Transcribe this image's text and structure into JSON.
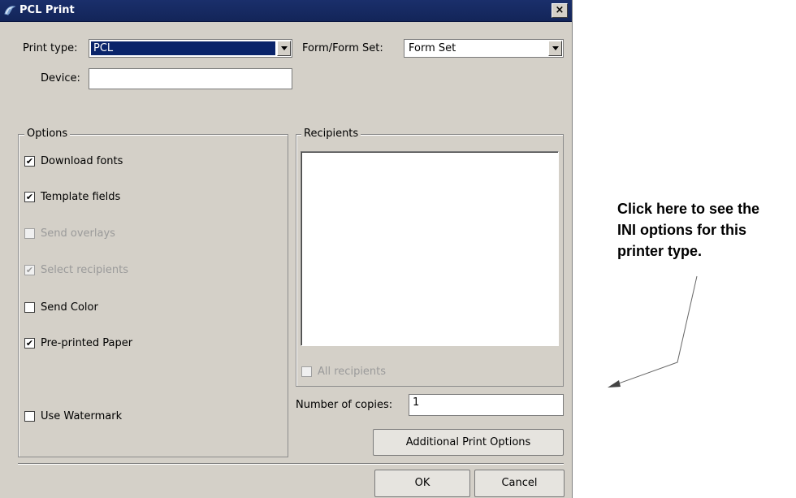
{
  "window": {
    "title": "PCL Print",
    "close_glyph": "×"
  },
  "print_type": {
    "label": "Print type:",
    "value": "PCL"
  },
  "form": {
    "label": "Form/Form Set:",
    "value": "Form Set"
  },
  "device": {
    "label": "Device:",
    "value": ""
  },
  "options": {
    "legend": "Options",
    "items": [
      {
        "label": "Download fonts",
        "checked": true,
        "enabled": true
      },
      {
        "label": "Template fields",
        "checked": true,
        "enabled": true
      },
      {
        "label": "Send overlays",
        "checked": false,
        "enabled": false
      },
      {
        "label": "Select recipients",
        "checked": true,
        "enabled": false
      },
      {
        "label": "Send Color",
        "checked": false,
        "enabled": true
      },
      {
        "label": "Pre-printed Paper",
        "checked": true,
        "enabled": true
      },
      {
        "label": "Use Watermark",
        "checked": false,
        "enabled": true
      }
    ]
  },
  "recipients": {
    "legend": "Recipients",
    "all_label": "All recipients",
    "all_checked": false
  },
  "copies": {
    "label": "Number of copies:",
    "value": "1"
  },
  "buttons": {
    "additional": "Additional Print Options",
    "ok": "OK",
    "cancel": "Cancel"
  },
  "annotation": {
    "lines": [
      "Click here to see the",
      "INI options for this",
      "printer type."
    ]
  }
}
